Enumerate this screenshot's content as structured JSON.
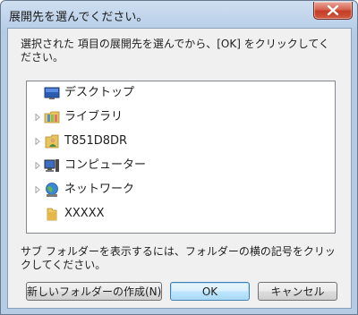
{
  "window": {
    "title": "展開先を選んでください。"
  },
  "description": "選択された 項目の展開先を選んでから、[OK] をクリックしてください。",
  "tree": {
    "items": [
      {
        "label": "デスクトップ",
        "icon": "desktop-icon",
        "expandable": false
      },
      {
        "label": "ライブラリ",
        "icon": "library-icon",
        "expandable": true
      },
      {
        "label": "T851D8DR",
        "icon": "user-folder-icon",
        "expandable": true
      },
      {
        "label": "コンピューター",
        "icon": "computer-icon",
        "expandable": true
      },
      {
        "label": "ネットワーク",
        "icon": "network-icon",
        "expandable": true
      },
      {
        "label": "XXXXX",
        "icon": "folder-icon",
        "expandable": false
      }
    ]
  },
  "hint": "サブ フォルダーを表示するには、フォルダーの横の記号をクリックしてください。",
  "buttons": {
    "new_folder": "新しいフォルダーの作成(N)",
    "ok": "OK",
    "cancel": "キャンセル"
  },
  "colors": {
    "frame": "#bcd1ea",
    "close_button": "#c94430",
    "ok_border": "#3c7fb1"
  }
}
